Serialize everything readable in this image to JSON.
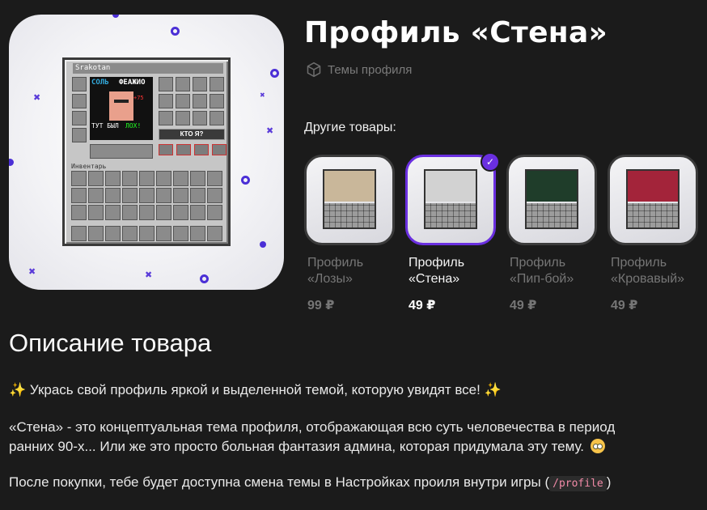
{
  "product": {
    "title": "Профиль «Стена»",
    "category": "Темы профиля",
    "category_icon": "cube-icon",
    "preview": {
      "player_name": "Srakotan",
      "poster_text_1": "СОЛЬ",
      "poster_text_2": "ФЕАЖИО",
      "poster_text_3": "ТУТ БЫЛ",
      "poster_text_4": "ЛОХ!",
      "poster_text_5": "+75",
      "button_label": "КТО Я?",
      "inventory_label": "Инвентарь"
    }
  },
  "other_products": {
    "label": "Другие товары:",
    "items": [
      {
        "name": "Профиль «Лозы»",
        "price": "99 ₽",
        "selected": false,
        "top_color": "#c9b79a"
      },
      {
        "name": "Профиль «Стена»",
        "price": "49 ₽",
        "selected": true,
        "top_color": "#d2d2d2"
      },
      {
        "name": "Профиль «Пип-бой»",
        "price": "49 ₽",
        "selected": false,
        "top_color": "#1f3d2a"
      },
      {
        "name": "Профиль «Кровавый»",
        "price": "49 ₽",
        "selected": false,
        "top_color": "#a3243a"
      }
    ]
  },
  "description": {
    "title": "Описание товара",
    "line1": "Укрась свой профиль яркой и выделенной темой, которую увидят все!",
    "line2": "«Стена» - это концептуальная тема профиля, отображающая всю суть человечества в период",
    "line3": "ранних 90-х... Или же это просто больная фантазия админа, которая придумала эту тему.",
    "line4_before": "После покупки, тебе будет доступна смена темы в Настройках проиля внутри игры (",
    "line4_code": "/profile",
    "line4_after": ")"
  },
  "colors": {
    "background": "#1b1b1b",
    "accent": "#6a2fe0",
    "muted_text": "#767676"
  }
}
